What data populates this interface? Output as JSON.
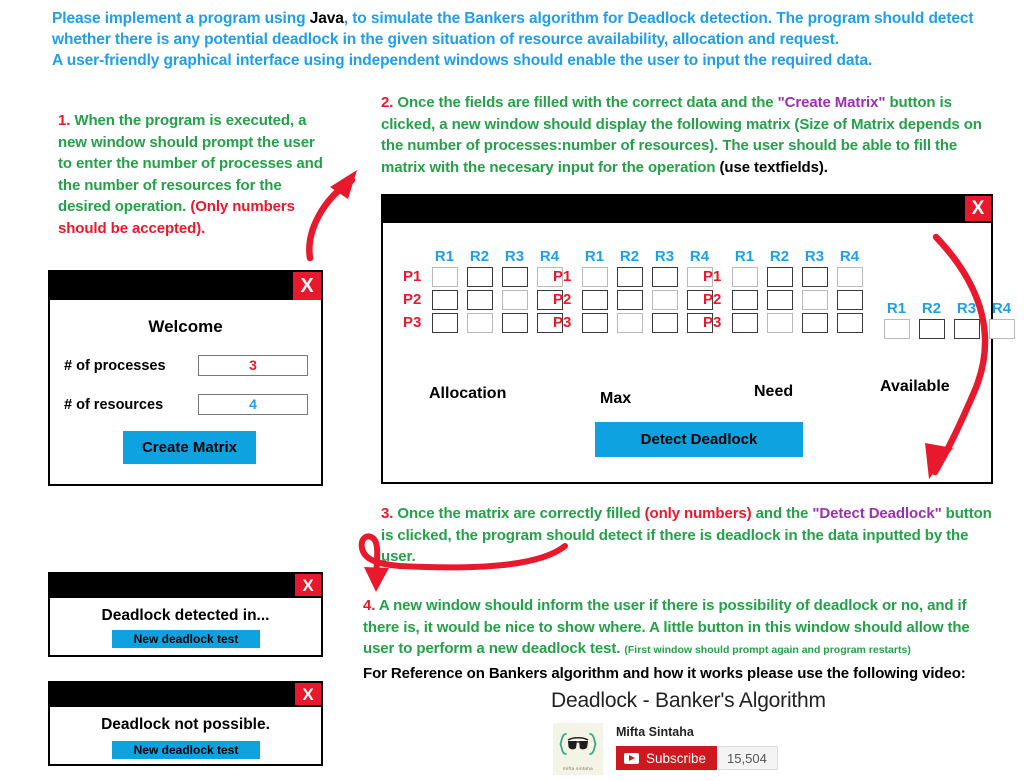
{
  "header": {
    "line1_a": "Please implement a program using ",
    "line1_kw": "Java",
    "line1_b": ",  to simulate the Bankers algorithm for Deadlock detection. The program should detect whether there is any potential deadlock in the given situation of resource availability, allocation and request.",
    "line3": "A user-friendly graphical interface using independent windows should enable the user to input the required data."
  },
  "instructions": {
    "item1": {
      "number": "1.",
      "body": " When the program is executed, a new window should prompt the user to enter the number of processes and the number of resources for the desired operation.",
      "note": "(Only numbers should be accepted)."
    },
    "item2": {
      "number": "2.",
      "body_a": " Once the fields are filled with the correct data and the ",
      "highlight": "\"Create Matrix\"",
      "body_b": " button is clicked, a new window should display the following matrix (Size of Matrix depends on the number of processes:number of resources). The user should be able to fill the matrix with the necesary input for the operation ",
      "bold_tail": "(use textfields)."
    },
    "item3": {
      "number": "3.",
      "body_a": " Once the matrix are correctly filled ",
      "red": "(only numbers)",
      "body_b": " and the ",
      "highlight": "\"Detect Deadlock\"",
      "body_c": " button is clicked, the program should detect if there is deadlock in the data inputted by the user."
    },
    "item4": {
      "number": "4.",
      "body": " A new window should inform the user if there is possibility of deadlock or no, and if there is, it would be nice to show where. A little button in this window should allow the user to perform a new deadlock test. ",
      "tiny": "(First window should prompt again and program restarts)",
      "reference": "For Reference on Bankers algorithm and how it works please use the following video:"
    }
  },
  "welcome_window": {
    "close_label": "X",
    "title": "Welcome",
    "processes_label": "# of processes",
    "processes_value": "3",
    "resources_label": "# of resources",
    "resources_value": "4",
    "create_button": "Create Matrix"
  },
  "matrix_window": {
    "close_label": "X",
    "resource_headers": [
      "R1",
      "R2",
      "R3",
      "R4"
    ],
    "process_labels": [
      "P1",
      "P2",
      "P3"
    ],
    "groups": [
      {
        "name": "Allocation",
        "label": "Allocation",
        "rows": 3
      },
      {
        "name": "Max",
        "label": "Max",
        "rows": 3
      },
      {
        "name": "Need",
        "label": "Need",
        "rows": 3
      },
      {
        "name": "Available",
        "label": "Available",
        "rows": 1
      }
    ],
    "cell_value": "",
    "detect_button": "Detect Deadlock"
  },
  "result_windows": [
    {
      "close_label": "X",
      "message": "Deadlock detected in...",
      "button": "New deadlock test"
    },
    {
      "close_label": "X",
      "message": "Deadlock not possible.",
      "button": "New deadlock test"
    }
  ],
  "video": {
    "title": "Deadlock - Banker's Algorithm",
    "channel": "Mifta Sintaha",
    "avatar_text": "mifta sintaha",
    "subscribe_label": "Subscribe",
    "subscriber_count": "15,504"
  },
  "colors": {
    "header_blue": "#1f9fe8",
    "instruction_green": "#24a148",
    "accent_red": "#e8192c",
    "highlight_purple": "#9b30b0",
    "button_blue": "#0fa2e0",
    "youtube_red": "#cc181e",
    "label_blue": "#1f9fe8"
  }
}
